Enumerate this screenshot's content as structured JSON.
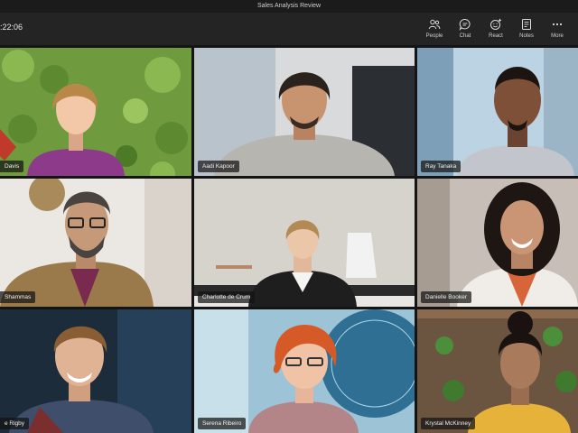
{
  "window": {
    "title": "Sales Analysis Review"
  },
  "meeting": {
    "timer": ":22:06"
  },
  "toolbar": {
    "items": [
      {
        "label": "People",
        "icon": "people-icon"
      },
      {
        "label": "Chat",
        "icon": "chat-icon"
      },
      {
        "label": "React",
        "icon": "react-icon"
      },
      {
        "label": "Notes",
        "icon": "notes-icon"
      },
      {
        "label": "More",
        "icon": "more-icon"
      }
    ]
  },
  "participants": [
    {
      "name": "Davis",
      "avatar": true
    },
    {
      "name": "Aadi Kapoor",
      "avatar": false
    },
    {
      "name": "Ray Tanaka",
      "avatar": true
    },
    {
      "name": "Shammas",
      "avatar": false
    },
    {
      "name": "Charlotte de Crum",
      "avatar": false
    },
    {
      "name": "Danielle Booker",
      "avatar": false
    },
    {
      "name": "e Rigby",
      "avatar": false
    },
    {
      "name": "Serena Ribeiro",
      "avatar": true
    },
    {
      "name": "Krystal McKinney",
      "avatar": true
    }
  ]
}
